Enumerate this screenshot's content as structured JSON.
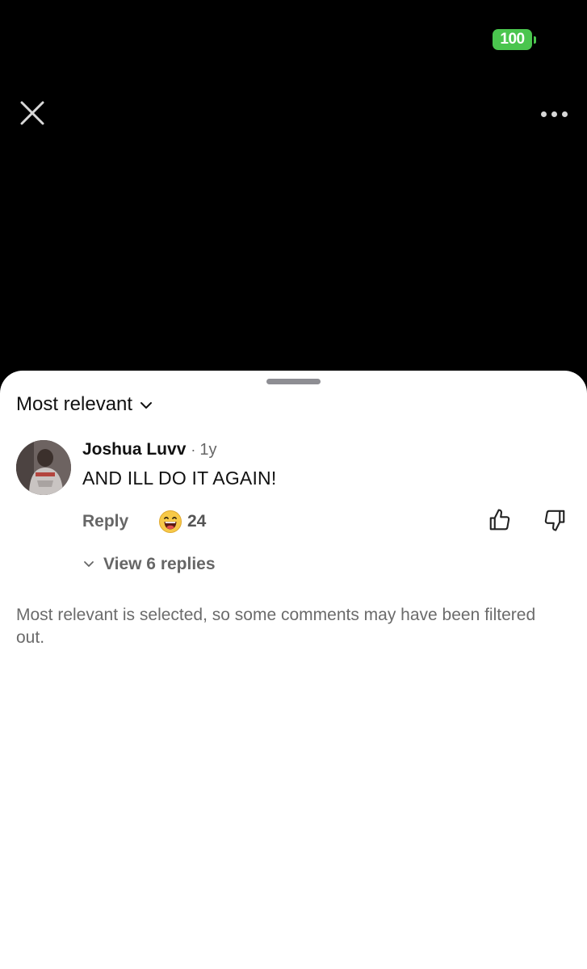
{
  "status_bar": {
    "battery_level": "100",
    "battery_color": "#4ac54e"
  },
  "top_controls": {
    "close_icon": "close-icon",
    "more_icon": "more-horizontal-icon"
  },
  "sheet": {
    "sort": {
      "label": "Most relevant",
      "icon": "chevron-down-icon"
    },
    "comments": [
      {
        "author": "Joshua Luvv",
        "separator": "·",
        "age": "1y",
        "text": "AND ILL DO IT AGAIN!",
        "reply_label": "Reply",
        "reaction_icon": "laughing-emoji-icon",
        "reaction_count": "24",
        "like_icon": "thumbs-up-icon",
        "dislike_icon": "thumbs-down-icon",
        "view_replies_label": "View 6 replies"
      }
    ],
    "filter_note": "Most relevant is selected, so some comments may have been filtered out."
  }
}
